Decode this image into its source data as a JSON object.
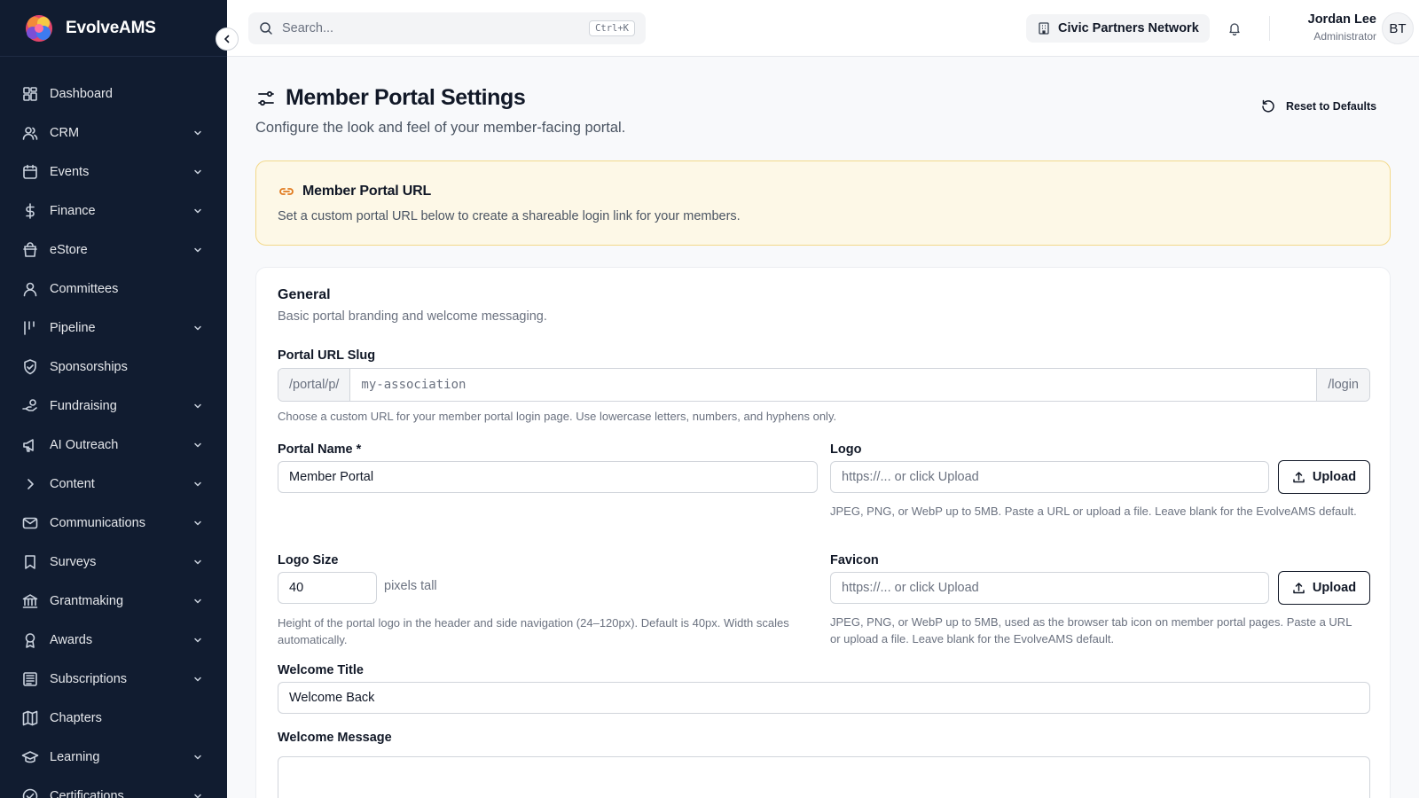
{
  "brand": {
    "name": "EvolveAMS"
  },
  "sidebar": {
    "items": [
      {
        "label": "Dashboard",
        "icon": "dashboard-icon",
        "expandable": false
      },
      {
        "label": "CRM",
        "icon": "users-icon",
        "expandable": true
      },
      {
        "label": "Events",
        "icon": "calendar-icon",
        "expandable": true
      },
      {
        "label": "Finance",
        "icon": "dollar-icon",
        "expandable": true
      },
      {
        "label": "eStore",
        "icon": "store-icon",
        "expandable": true
      },
      {
        "label": "Committees",
        "icon": "committees-icon",
        "expandable": false
      },
      {
        "label": "Pipeline",
        "icon": "pipeline-icon",
        "expandable": true
      },
      {
        "label": "Sponsorships",
        "icon": "sponsorship-icon",
        "expandable": false
      },
      {
        "label": "Fundraising",
        "icon": "hand-coin-icon",
        "expandable": true
      },
      {
        "label": "AI Outreach",
        "icon": "megaphone-icon",
        "expandable": true
      },
      {
        "label": "Content",
        "icon": "chevron-right-icon",
        "expandable": true
      },
      {
        "label": "Communications",
        "icon": "mail-icon",
        "expandable": true
      },
      {
        "label": "Surveys",
        "icon": "bookmark-icon",
        "expandable": true
      },
      {
        "label": "Grantmaking",
        "icon": "bank-icon",
        "expandable": true
      },
      {
        "label": "Awards",
        "icon": "award-icon",
        "expandable": true
      },
      {
        "label": "Subscriptions",
        "icon": "newspaper-icon",
        "expandable": true
      },
      {
        "label": "Chapters",
        "icon": "map-icon",
        "expandable": false
      },
      {
        "label": "Learning",
        "icon": "graduation-cap-icon",
        "expandable": true
      },
      {
        "label": "Certifications",
        "icon": "badge-check-icon",
        "expandable": true
      }
    ]
  },
  "topbar": {
    "search_placeholder": "Search...",
    "search_shortcut": "Ctrl+K",
    "org_name": "Civic Partners Network",
    "user_name": "Jordan Lee",
    "user_role": "Administrator",
    "avatar_initials": "BT"
  },
  "page": {
    "title": "Member Portal Settings",
    "subtitle": "Configure the look and feel of your member-facing portal.",
    "reset_label": "Reset to Defaults"
  },
  "notice": {
    "title": "Member Portal URL",
    "text": "Set a custom portal URL below to create a shareable login link for your members."
  },
  "general": {
    "title": "General",
    "subtitle": "Basic portal branding and welcome messaging.",
    "slug": {
      "label": "Portal URL Slug",
      "prefix": "/portal/p/",
      "placeholder": "my-association",
      "suffix": "/login",
      "help": "Choose a custom URL for your member portal login page. Use lowercase letters, numbers, and hyphens only."
    },
    "portal_name": {
      "label": "Portal Name *",
      "value": "Member Portal"
    },
    "logo": {
      "label": "Logo",
      "placeholder": "https://... or click Upload",
      "upload_label": "Upload",
      "help": "JPEG, PNG, or WebP up to 5MB. Paste a URL or upload a file. Leave blank for the EvolveAMS default."
    },
    "logo_size": {
      "label": "Logo Size",
      "value": "40",
      "unit": "pixels tall",
      "help": "Height of the portal logo in the header and side navigation (24–120px). Default is 40px. Width scales automatically."
    },
    "favicon": {
      "label": "Favicon",
      "placeholder": "https://... or click Upload",
      "upload_label": "Upload",
      "help": "JPEG, PNG, or WebP up to 5MB, used as the browser tab icon on member portal pages. Paste a URL or upload a file. Leave blank for the EvolveAMS default."
    },
    "welcome_title": {
      "label": "Welcome Title",
      "value": "Welcome Back"
    },
    "welcome_message": {
      "label": "Welcome Message",
      "value": ""
    }
  },
  "colors": {
    "sidebar_bg": "#111c30",
    "notice_bg": "#fdf8e7",
    "notice_border": "#f3d98a",
    "notice_icon": "#e07a1f"
  }
}
